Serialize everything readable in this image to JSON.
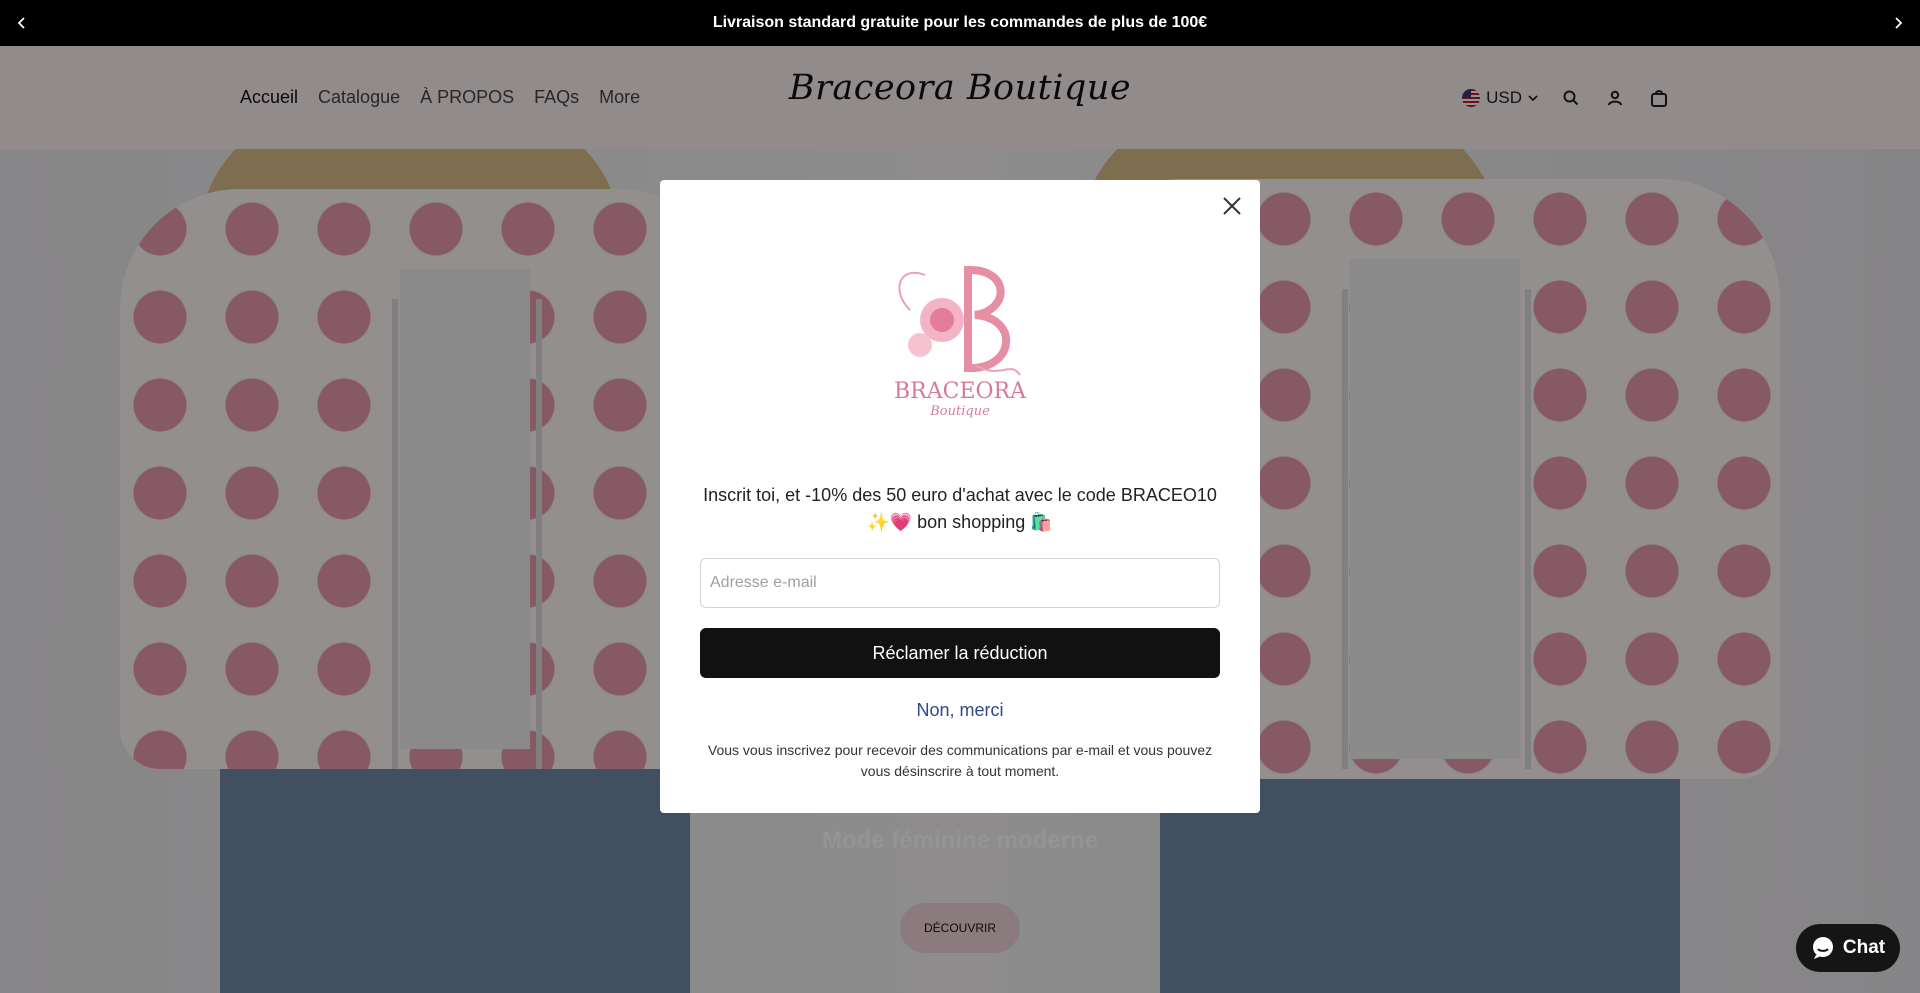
{
  "announcement": {
    "text": "Livraison standard gratuite pour les commandes de plus de 100€",
    "prev_icon": "chevron-left-icon",
    "next_icon": "chevron-right-icon"
  },
  "header": {
    "logo_text": "Braceora Boutique",
    "nav": [
      {
        "label": "Accueil",
        "active": true
      },
      {
        "label": "Catalogue"
      },
      {
        "label": "À PROPOS"
      },
      {
        "label": "FAQs"
      },
      {
        "label": "More"
      }
    ],
    "currency": "USD",
    "icons": [
      "search-icon",
      "account-icon",
      "bag-icon"
    ]
  },
  "hero": {
    "subtitle": "Mode féminine moderne",
    "button_label": "DÉCOUVRIR"
  },
  "popup": {
    "logo_brand": "BRACEORA",
    "logo_sub": "Boutique",
    "message": "Inscrit toi, et -10% des 50 euro d'achat avec le code BRACEO10 ✨💗 bon shopping 🛍️",
    "email_placeholder": "Adresse e-mail",
    "email_value": "",
    "submit_label": "Réclamer la réduction",
    "decline_label": "Non, merci",
    "disclaimer": "Vous vous inscrivez pour recevoir des communications par e-mail et vous pouvez vous désinscrire à tout moment."
  },
  "chat": {
    "label": "Chat",
    "icon": "chat-bubble-icon"
  },
  "colors": {
    "announcement_bg": "#000000",
    "header_bg": "#fbeff0",
    "cta_bg": "#111111",
    "link": "#2c4a8b",
    "jacket_pink": "#e58fa4"
  }
}
